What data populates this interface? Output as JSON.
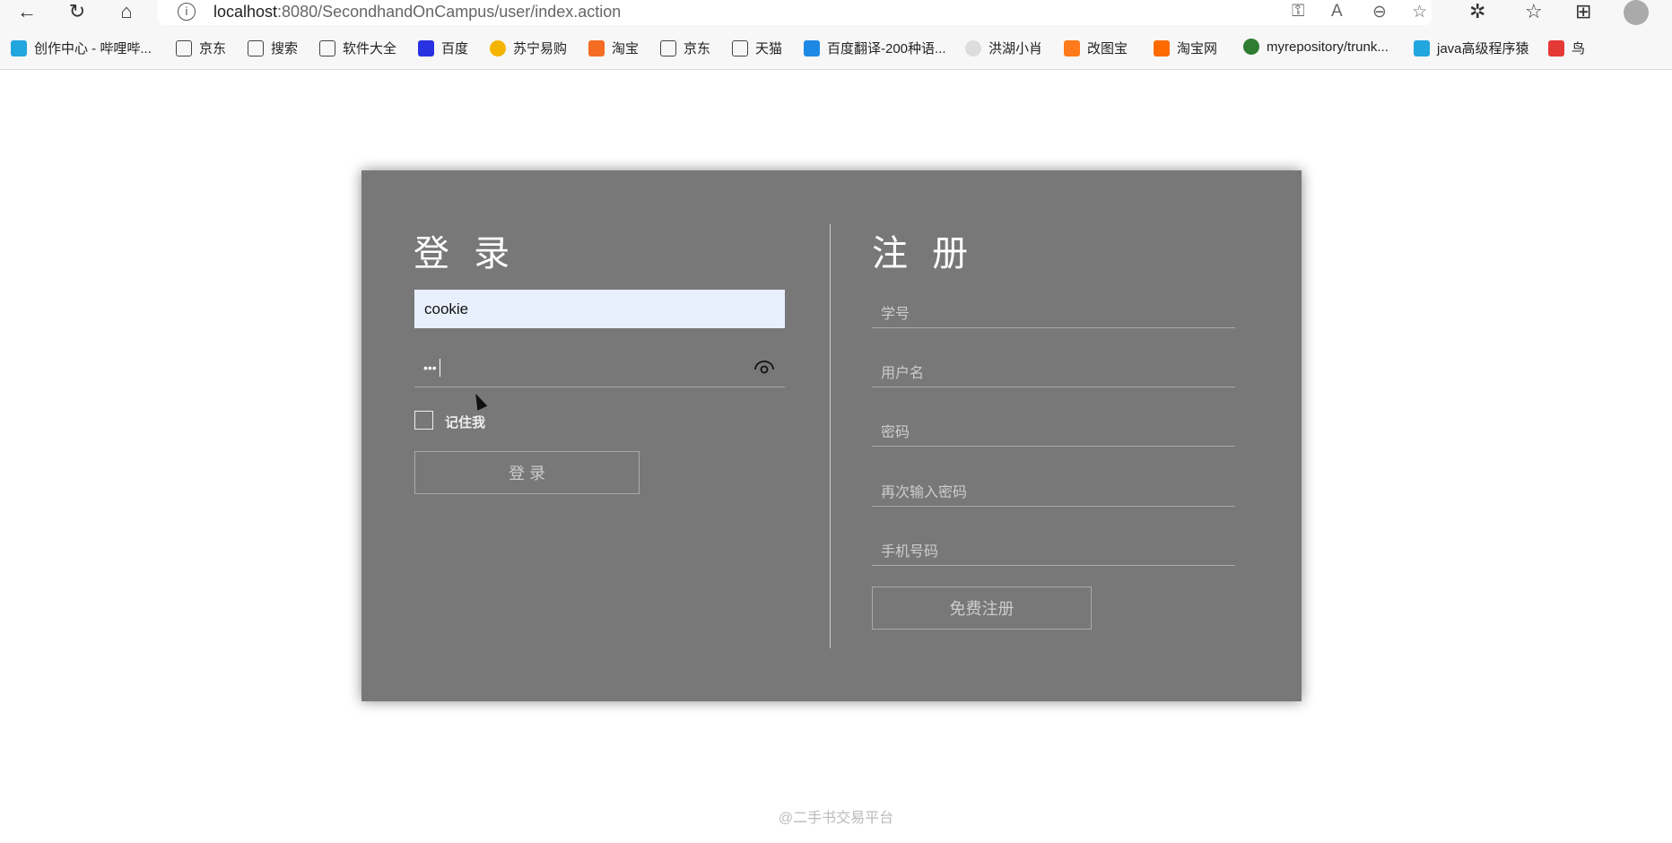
{
  "browser": {
    "url_host": "localhost",
    "url_rest": ":8080/SecondhandOnCampus/user/index.action",
    "bookmarks": [
      "创作中心 - 哔哩哔...",
      "京东",
      "搜索",
      "软件大全",
      "百度",
      "苏宁易购",
      "淘宝",
      "京东",
      "天猫",
      "百度翻译-200种语...",
      "洪湖小肖",
      "改图宝",
      "淘宝网",
      "myrepository/trunk...",
      "java高级程序猿",
      "鸟"
    ]
  },
  "login": {
    "title": "登 录",
    "username_value": "cookie",
    "password_mask": "•••",
    "remember_label": "记住我",
    "submit_label": "登 录"
  },
  "register": {
    "title": "注 册",
    "fields": [
      "学号",
      "用户名",
      "密码",
      "再次输入密码",
      "手机号码"
    ],
    "submit_label": "免费注册"
  },
  "footer": "@二手书交易平台"
}
